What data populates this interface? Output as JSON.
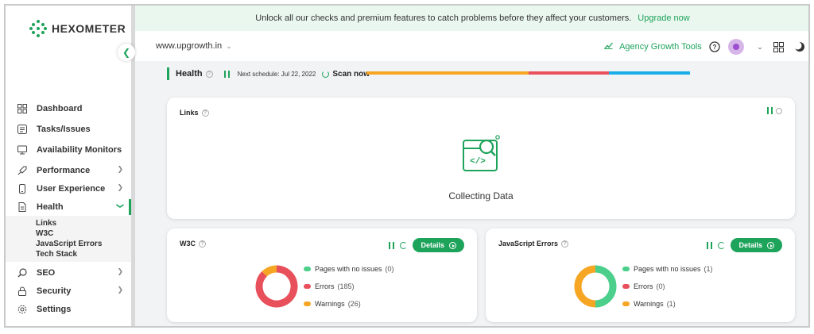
{
  "brand": {
    "name": "HEXOMETER",
    "accent": "#1ea35b"
  },
  "banner": {
    "text": "Unlock all our checks and premium features to catch problems before they affect your customers.",
    "link": "Upgrade now"
  },
  "topbar": {
    "site": "www.upgrowth.in",
    "agency_tools": "Agency Growth Tools"
  },
  "sidebar": {
    "items": [
      {
        "label": "Dashboard",
        "icon": "dashboard-icon"
      },
      {
        "label": "Tasks/Issues",
        "icon": "tasks-icon"
      },
      {
        "label": "Availability Monitors",
        "icon": "monitor-icon"
      },
      {
        "label": "Performance",
        "icon": "rocket-icon"
      },
      {
        "label": "User Experience",
        "icon": "mobile-icon"
      },
      {
        "label": "Health",
        "icon": "document-icon"
      },
      {
        "label": "SEO",
        "icon": "search-icon"
      },
      {
        "label": "Security",
        "icon": "lock-icon"
      },
      {
        "label": "Settings",
        "icon": "gear-icon"
      }
    ],
    "health_sub": [
      "Links",
      "W3C",
      "JavaScript Errors",
      "Tech Stack"
    ]
  },
  "health": {
    "title": "Health",
    "schedule": "Next schedule: Jul 22, 2022",
    "scan": "Scan now",
    "progress_colors": [
      "#f6a623",
      "#e8505b",
      "#1aaee8"
    ]
  },
  "links_card": {
    "title": "Links",
    "status": "Collecting Data"
  },
  "w3c_card": {
    "title": "W3C",
    "details": "Details",
    "legend": [
      {
        "label": "Pages with no issues",
        "count": "(0)",
        "color": "#4ccf8a"
      },
      {
        "label": "Errors",
        "count": "(185)",
        "color": "#e8505b"
      },
      {
        "label": "Warnings",
        "count": "(26)",
        "color": "#f6a623"
      }
    ],
    "values": [
      0,
      185,
      26
    ]
  },
  "js_card": {
    "title": "JavaScript Errors",
    "details": "Details",
    "legend": [
      {
        "label": "Pages with no issues",
        "count": "(1)",
        "color": "#4ccf8a"
      },
      {
        "label": "Errors",
        "count": "(0)",
        "color": "#e8505b"
      },
      {
        "label": "Warnings",
        "count": "(1)",
        "color": "#f6a623"
      }
    ],
    "values": [
      1,
      0,
      1
    ]
  }
}
